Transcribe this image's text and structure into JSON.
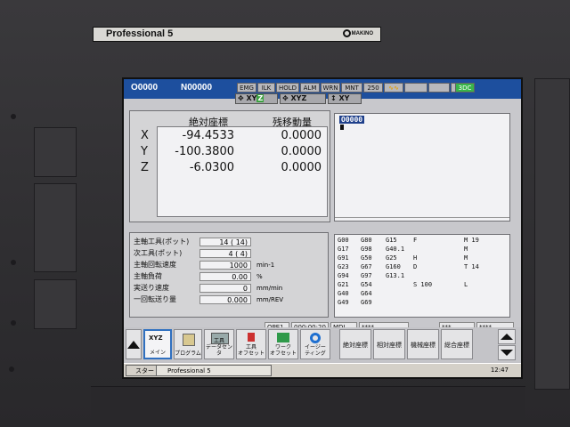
{
  "bezel": {
    "brand": "Professional  5",
    "logo": "MAKINO"
  },
  "header": {
    "o_number": "O0000",
    "n_number": "N00000",
    "status_lights": [
      "EMG",
      "ILK",
      "HOLD",
      "ALM",
      "WRN",
      "MNT",
      "250",
      "∿∿",
      "",
      "",
      "",
      "3DC"
    ]
  },
  "axis_buttons": [
    {
      "icon": "move-icon",
      "axes": [
        "X",
        "Y",
        "Z"
      ],
      "active": "Z"
    },
    {
      "icon": "move-icon",
      "axes": [
        "X",
        "Y",
        "Z"
      ]
    },
    {
      "icon": "jog-icon",
      "axes": [
        "X",
        "Y"
      ]
    }
  ],
  "coordinates": {
    "heading_abs": "絶対座標",
    "heading_rem": "残移動量",
    "rows": [
      {
        "axis": "X",
        "abs": "-94.4533",
        "rem": "0.0000"
      },
      {
        "axis": "Y",
        "abs": "-100.3800",
        "rem": "0.0000"
      },
      {
        "axis": "Z",
        "abs": "-6.0300",
        "rem": "0.0000"
      }
    ]
  },
  "program": {
    "number": "O0000"
  },
  "status": {
    "spindle_tool": {
      "label": "主軸工具(ポット)",
      "value": "14  ( 14)",
      "unit": ""
    },
    "next_tool": {
      "label": "次工具(ポット)",
      "value": "4  (  4)",
      "unit": ""
    },
    "spindle_speed": {
      "label": "主軸回転速度",
      "value": "1000",
      "unit": "min-1"
    },
    "spindle_load": {
      "label": "主軸負荷",
      "value": "0.00",
      "unit": "%"
    },
    "feed_rate": {
      "label": "実送り速度",
      "value": "0",
      "unit": "mm/min"
    },
    "feed_per_rev": {
      "label": "一回転送り量",
      "value": "0.000",
      "unit": "mm/REV"
    }
  },
  "modal": {
    "col1": [
      "G00",
      "G17",
      "G91",
      "G23",
      "G94",
      "G21",
      "G40",
      "G49"
    ],
    "col2": [
      "G80",
      "G98",
      "G50",
      "G67",
      "G97",
      "G54",
      "G64",
      "G69"
    ],
    "col3": [
      "G15",
      "G40.1",
      "G25",
      "G160",
      "G13.1",
      "",
      "",
      ""
    ],
    "col4": [
      "F",
      "",
      "H",
      "D",
      "",
      "S 100",
      "",
      ""
    ],
    "col5": [
      "M 19",
      "M",
      "M",
      "T 14",
      "",
      "L",
      "",
      ""
    ]
  },
  "message_row": {
    "ope": "OPE1",
    "time": "000:00:20",
    "mdi": "MDI",
    "f1": "****",
    "f2": "***",
    "f3": "****"
  },
  "softkeys": {
    "xyz": {
      "icon": "XYZ",
      "label": "メイン"
    },
    "program": {
      "label": "プログラム"
    },
    "tool_data": {
      "label": "工具\nデータセンタ"
    },
    "tool_offset": {
      "label": "工具\nオフセット"
    },
    "work_offset": {
      "label": "ワーク\nオフセット"
    },
    "easy": {
      "label": "イージー\nティング"
    },
    "abs_coord": "絶対座標",
    "rel_coord": "相対座標",
    "mach_coord": "機械座標",
    "total_coord": "総合座標"
  },
  "taskbar": {
    "start": "スタート",
    "app": "Professional 5",
    "time": "12:47"
  }
}
